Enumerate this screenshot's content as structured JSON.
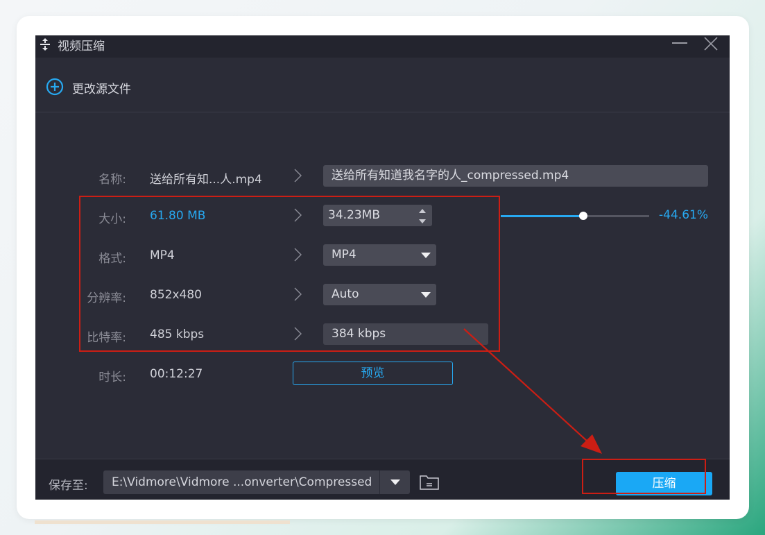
{
  "window": {
    "title": "视频压缩",
    "change_source_label": "更改源文件"
  },
  "rows": {
    "name": {
      "label": "名称:",
      "source": "送给所有知...人.mp4",
      "target": "送给所有知道我名字的人_compressed.mp4"
    },
    "size": {
      "label": "大小:",
      "source": "61.80 MB",
      "target": "34.23MB",
      "percent": "-44.61%",
      "slider_fraction": 0.554
    },
    "format": {
      "label": "格式:",
      "source": "MP4",
      "target": "MP4"
    },
    "resolution": {
      "label": "分辨率:",
      "source": "852x480",
      "target": "Auto"
    },
    "bitrate": {
      "label": "比特率:",
      "source": "485 kbps",
      "target": "384 kbps"
    },
    "duration": {
      "label": "时长:",
      "source": "00:12:27"
    }
  },
  "preview_label": "预览",
  "bottom": {
    "save_label": "保存至:",
    "path": "E:\\Vidmore\\Vidmore ...onverter\\Compressed",
    "compress_label": "压缩"
  },
  "colors": {
    "accent": "#27a9f1",
    "highlight": "#cc1e14",
    "window_bg": "#2b2c37"
  },
  "icons": [
    "compress-icon",
    "minimize-icon",
    "close-icon",
    "add-circle-icon",
    "chevron-right-icon",
    "dropdown-arrow-icon",
    "folder-icon"
  ]
}
